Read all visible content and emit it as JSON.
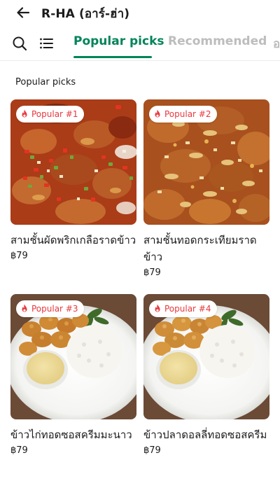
{
  "header": {
    "title": "R-HA (อาร์-ฮ่า)",
    "back_icon": "arrow-left-icon"
  },
  "tabs": {
    "search_icon": "search-icon",
    "menu_icon": "list-menu-icon",
    "items": [
      {
        "label": "Popular picks",
        "active": true
      },
      {
        "label": "Recommended",
        "active": false
      },
      {
        "label": "อ",
        "active": false
      }
    ],
    "active_color": "#00845a",
    "inactive_color": "#bdbdbd"
  },
  "section": {
    "title": "Popular picks"
  },
  "items": [
    {
      "badge": "Popular #1",
      "name": "สามชั้นผัดพริกเกลือราดข้าว",
      "price": "฿79",
      "image": "crispy-pork-chili-salt"
    },
    {
      "badge": "Popular #2",
      "name": "สามชั้นทอดกระเทียมราดข้าว",
      "price": "฿79",
      "image": "crispy-pork-garlic"
    },
    {
      "badge": "Popular #3",
      "name": "ข้าวไก่ทอดซอสครีมมะนาว",
      "price": "฿79",
      "image": "fried-chicken-rice-cream-sauce"
    },
    {
      "badge": "Popular #4",
      "name": "ข้าวปลาดอลลี่ทอดซอสครีม",
      "price": "฿79",
      "image": "fried-dory-rice-cream-sauce"
    }
  ],
  "colors": {
    "badge_text": "#e8383d",
    "accent": "#00845a"
  }
}
